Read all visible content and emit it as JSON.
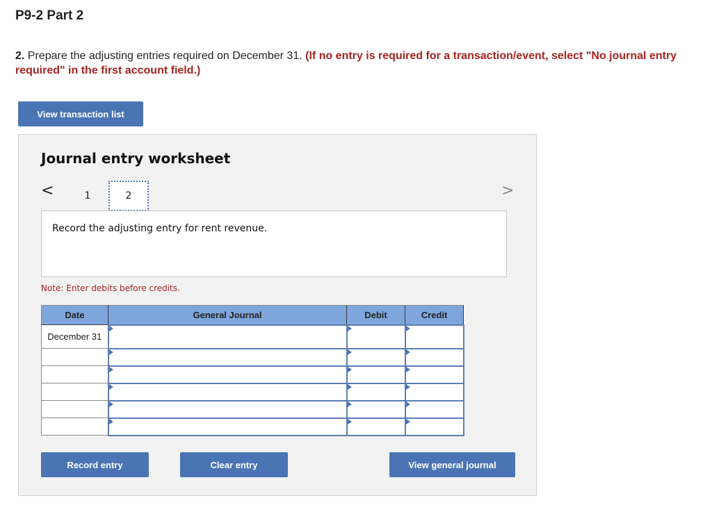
{
  "header": {
    "title": "P9-2 Part 2",
    "instruction_number": "2.",
    "instruction_text": " Prepare the adjusting entries required on December 31. ",
    "instruction_note": "(If no entry is required for a transaction/event, select \"No journal entry required\" in the first account field.)"
  },
  "buttons": {
    "view_transaction_list": "View transaction list",
    "record_entry": "Record entry",
    "clear_entry": "Clear entry",
    "view_general_journal": "View general journal"
  },
  "worksheet": {
    "title": "Journal entry worksheet",
    "nav_prev": "<",
    "nav_next": ">",
    "tabs": [
      {
        "label": "1",
        "active": false
      },
      {
        "label": "2",
        "active": true
      }
    ],
    "description": "Record the adjusting entry for rent revenue.",
    "note": "Note: Enter debits before credits."
  },
  "journal_table": {
    "headers": {
      "date": "Date",
      "general_journal": "General Journal",
      "debit": "Debit",
      "credit": "Credit"
    },
    "rows": [
      {
        "date": "December 31",
        "account": "",
        "debit": "",
        "credit": ""
      },
      {
        "date": "",
        "account": "",
        "debit": "",
        "credit": ""
      },
      {
        "date": "",
        "account": "",
        "debit": "",
        "credit": ""
      },
      {
        "date": "",
        "account": "",
        "debit": "",
        "credit": ""
      },
      {
        "date": "",
        "account": "",
        "debit": "",
        "credit": ""
      },
      {
        "date": "",
        "account": "",
        "debit": "",
        "credit": ""
      }
    ]
  },
  "colors": {
    "button_blue": "#4a74b4",
    "header_blue": "#7fa6dc",
    "warning_red": "#a32522"
  }
}
